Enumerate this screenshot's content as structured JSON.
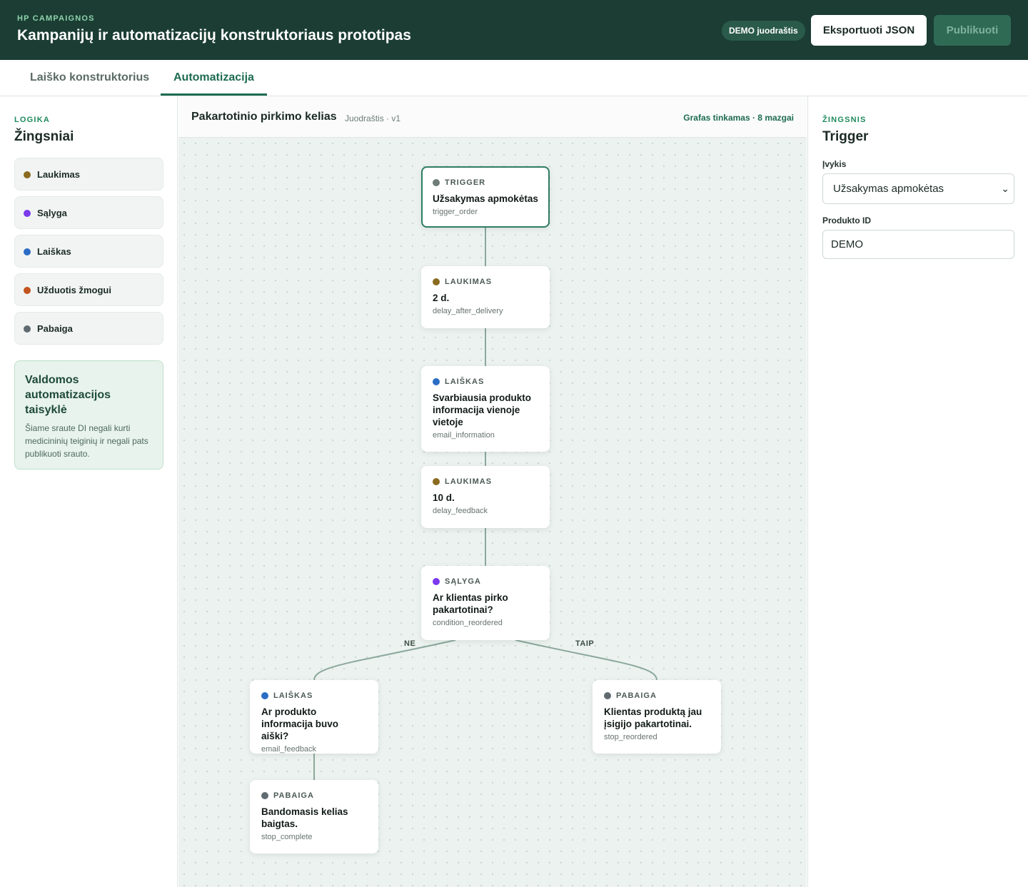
{
  "header": {
    "brand": "HP CAMPAIGNOS",
    "title": "Kampanijų ir automatizacijų konstruktoriaus prototipas",
    "badge": "DEMO juodraštis",
    "export_label": "Eksportuoti JSON",
    "publish_label": "Publikuoti"
  },
  "tabs": [
    {
      "label": "Laiško konstruktorius",
      "active": false
    },
    {
      "label": "Automatizacija",
      "active": true
    }
  ],
  "sidebar": {
    "kicker": "LOGIKA",
    "heading": "Žingsniai",
    "items": [
      {
        "label": "Laukimas",
        "color": "#8a6a1f"
      },
      {
        "label": "Sąlyga",
        "color": "#7c3aed"
      },
      {
        "label": "Laiškas",
        "color": "#2b6cc4"
      },
      {
        "label": "Užduotis žmogui",
        "color": "#c2541c"
      },
      {
        "label": "Pabaiga",
        "color": "#5f6b70"
      }
    ],
    "rules_title": "Valdomos automatizacijos taisyklė",
    "rules_text": "Šiame sraute DI negali kurti medicininių teiginių ir negali pats publikuoti srauto."
  },
  "canvas": {
    "flow_name": "Pakartotinio pirkimo kelias",
    "flow_status": "Juodraštis · v1",
    "validation": "Grafas tinkamas · 8 mazgai",
    "branch_no": "NE",
    "branch_yes": "TAIP",
    "nodes": [
      {
        "type": "TRIGGER",
        "title": "Užsakymas apmokėtas",
        "id": "trigger_order",
        "color": "#6f7c77"
      },
      {
        "type": "LAUKIMAS",
        "title": "2 d.",
        "id": "delay_after_delivery",
        "color": "#8a6a1f"
      },
      {
        "type": "LAIŠKAS",
        "title": "Svarbiausia produkto informacija vienoje vietoje",
        "id": "email_information",
        "color": "#2b6cc4"
      },
      {
        "type": "LAUKIMAS",
        "title": "10 d.",
        "id": "delay_feedback",
        "color": "#8a6a1f"
      },
      {
        "type": "SĄLYGA",
        "title": "Ar klientas pirko pakartotinai?",
        "id": "condition_reordered",
        "color": "#7c3aed"
      },
      {
        "type": "LAIŠKAS",
        "title": "Ar produkto informacija buvo aiški?",
        "id": "email_feedback",
        "color": "#2b6cc4"
      },
      {
        "type": "PABAIGA",
        "title": "Klientas produktą jau įsigijo pakartotinai.",
        "id": "stop_reordered",
        "color": "#5f6b70"
      },
      {
        "type": "PABAIGA",
        "title": "Bandomasis kelias baigtas.",
        "id": "stop_complete",
        "color": "#5f6b70"
      }
    ]
  },
  "inspector": {
    "kicker": "ŽINGSNIS",
    "heading": "Trigger",
    "event_label": "Įvykis",
    "event_value": "Užsakymas apmokėtas",
    "product_label": "Produkto ID",
    "product_value": "DEMO"
  }
}
